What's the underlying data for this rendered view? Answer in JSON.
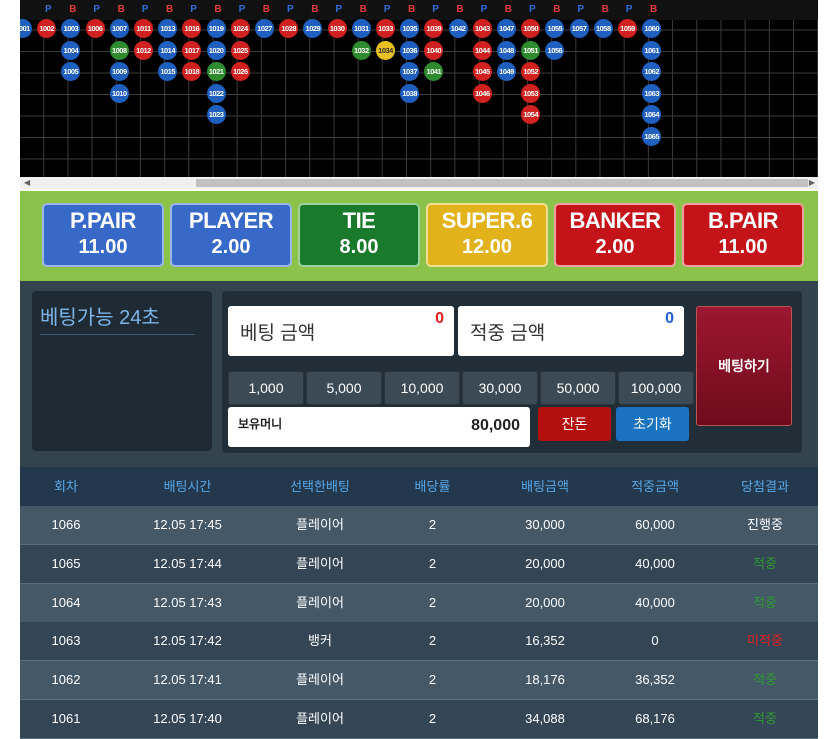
{
  "road": {
    "header": [
      "P",
      "B",
      "P",
      "B",
      "P",
      "B",
      "P",
      "B",
      "P",
      "B",
      "P",
      "B",
      "P",
      "B",
      "P",
      "B",
      "P",
      "B",
      "P",
      "B",
      "P",
      "B",
      "P",
      "B",
      "P",
      "B"
    ],
    "beads": [
      {
        "t": "1001",
        "c": "blue",
        "col": 0,
        "row": 0
      },
      {
        "t": "1002",
        "c": "red",
        "col": 1,
        "row": 0
      },
      {
        "t": "1003",
        "c": "blue",
        "col": 2,
        "row": 0
      },
      {
        "t": "1004",
        "c": "blue",
        "col": 2,
        "row": 1
      },
      {
        "t": "1005",
        "c": "blue",
        "col": 2,
        "row": 2
      },
      {
        "t": "1006",
        "c": "red",
        "col": 3,
        "row": 0
      },
      {
        "t": "1007",
        "c": "blue",
        "col": 4,
        "row": 0
      },
      {
        "t": "1008",
        "c": "green",
        "col": 4,
        "row": 1
      },
      {
        "t": "1009",
        "c": "blue",
        "col": 4,
        "row": 2
      },
      {
        "t": "1010",
        "c": "blue",
        "col": 4,
        "row": 3
      },
      {
        "t": "1011",
        "c": "red",
        "col": 5,
        "row": 0
      },
      {
        "t": "1012",
        "c": "red",
        "col": 5,
        "row": 1
      },
      {
        "t": "1013",
        "c": "blue",
        "col": 6,
        "row": 0
      },
      {
        "t": "1014",
        "c": "blue",
        "col": 6,
        "row": 1
      },
      {
        "t": "1015",
        "c": "blue",
        "col": 6,
        "row": 2
      },
      {
        "t": "1016",
        "c": "red",
        "col": 7,
        "row": 0
      },
      {
        "t": "1017",
        "c": "red",
        "col": 7,
        "row": 1
      },
      {
        "t": "1018",
        "c": "red",
        "col": 7,
        "row": 2
      },
      {
        "t": "1019",
        "c": "blue",
        "col": 8,
        "row": 0
      },
      {
        "t": "1020",
        "c": "blue",
        "col": 8,
        "row": 1
      },
      {
        "t": "1021",
        "c": "green",
        "col": 8,
        "row": 2
      },
      {
        "t": "1022",
        "c": "blue",
        "col": 8,
        "row": 3
      },
      {
        "t": "1023",
        "c": "blue",
        "col": 8,
        "row": 4
      },
      {
        "t": "1024",
        "c": "red",
        "col": 9,
        "row": 0
      },
      {
        "t": "1025",
        "c": "red",
        "col": 9,
        "row": 1
      },
      {
        "t": "1026",
        "c": "red",
        "col": 9,
        "row": 2
      },
      {
        "t": "1027",
        "c": "blue",
        "col": 10,
        "row": 0
      },
      {
        "t": "1028",
        "c": "red",
        "col": 11,
        "row": 0
      },
      {
        "t": "1029",
        "c": "blue",
        "col": 12,
        "row": 0
      },
      {
        "t": "1030",
        "c": "red",
        "col": 13,
        "row": 0
      },
      {
        "t": "1031",
        "c": "blue",
        "col": 14,
        "row": 0
      },
      {
        "t": "1032",
        "c": "green",
        "col": 14,
        "row": 1
      },
      {
        "t": "1033",
        "c": "red",
        "col": 15,
        "row": 0
      },
      {
        "t": "1034",
        "c": "yellow",
        "col": 15,
        "row": 1
      },
      {
        "t": "1035",
        "c": "blue",
        "col": 16,
        "row": 0
      },
      {
        "t": "1036",
        "c": "blue",
        "col": 16,
        "row": 1
      },
      {
        "t": "1037",
        "c": "blue",
        "col": 16,
        "row": 2
      },
      {
        "t": "1038",
        "c": "blue",
        "col": 16,
        "row": 3
      },
      {
        "t": "1039",
        "c": "red",
        "col": 17,
        "row": 0
      },
      {
        "t": "1040",
        "c": "red",
        "col": 17,
        "row": 1
      },
      {
        "t": "1041",
        "c": "green",
        "col": 17,
        "row": 2
      },
      {
        "t": "1042",
        "c": "blue",
        "col": 18,
        "row": 0
      },
      {
        "t": "1043",
        "c": "red",
        "col": 19,
        "row": 0
      },
      {
        "t": "1044",
        "c": "red",
        "col": 19,
        "row": 1
      },
      {
        "t": "1045",
        "c": "red",
        "col": 19,
        "row": 2
      },
      {
        "t": "1046",
        "c": "red",
        "col": 19,
        "row": 3
      },
      {
        "t": "1047",
        "c": "blue",
        "col": 20,
        "row": 0
      },
      {
        "t": "1048",
        "c": "blue",
        "col": 20,
        "row": 1
      },
      {
        "t": "1049",
        "c": "blue",
        "col": 20,
        "row": 2
      },
      {
        "t": "1050",
        "c": "red",
        "col": 21,
        "row": 0
      },
      {
        "t": "1051",
        "c": "green",
        "col": 21,
        "row": 1
      },
      {
        "t": "1052",
        "c": "red",
        "col": 21,
        "row": 2
      },
      {
        "t": "1053",
        "c": "red",
        "col": 21,
        "row": 3
      },
      {
        "t": "1054",
        "c": "red",
        "col": 21,
        "row": 4
      },
      {
        "t": "1055",
        "c": "blue",
        "col": 22,
        "row": 0
      },
      {
        "t": "1056",
        "c": "blue",
        "col": 22,
        "row": 1
      },
      {
        "t": "1057",
        "c": "blue",
        "col": 23,
        "row": 0
      },
      {
        "t": "1058",
        "c": "blue",
        "col": 24,
        "row": 0
      },
      {
        "t": "1059",
        "c": "red",
        "col": 25,
        "row": 0
      },
      {
        "t": "1060",
        "c": "blue",
        "col": 26,
        "row": 0
      },
      {
        "t": "1061",
        "c": "blue",
        "col": 26,
        "row": 1
      },
      {
        "t": "1062",
        "c": "blue",
        "col": 26,
        "row": 2
      },
      {
        "t": "1063",
        "c": "blue",
        "col": 26,
        "row": 3
      },
      {
        "t": "1064",
        "c": "blue",
        "col": 26,
        "row": 4
      },
      {
        "t": "1065",
        "c": "blue",
        "col": 26,
        "row": 5
      }
    ]
  },
  "bets": [
    {
      "title": "P.PAIR",
      "odds": "11.00",
      "color": "blue"
    },
    {
      "title": "PLAYER",
      "odds": "2.00",
      "color": "blue"
    },
    {
      "title": "TIE",
      "odds": "8.00",
      "color": "green"
    },
    {
      "title": "SUPER.6",
      "odds": "12.00",
      "color": "yellow"
    },
    {
      "title": "BANKER",
      "odds": "2.00",
      "color": "red"
    },
    {
      "title": "B.PAIR",
      "odds": "11.00",
      "color": "red"
    }
  ],
  "timer": {
    "label": "베팅가능 24초"
  },
  "bet_amount": {
    "label": "베팅 금액",
    "value": "0",
    "value_color": "#e02020"
  },
  "win_amount": {
    "label": "적중 금액",
    "value": "0",
    "value_color": "#2060d0"
  },
  "chips": [
    "1,000",
    "5,000",
    "10,000",
    "30,000",
    "50,000",
    "100,000"
  ],
  "holding": {
    "label": "보유머니",
    "value": "80,000"
  },
  "buttons": {
    "change": "잔돈",
    "reset": "초기화",
    "place_bet": "베팅하기"
  },
  "history": {
    "headers": [
      "회차",
      "배팅시간",
      "선택한배팅",
      "배당률",
      "배팅금액",
      "적중금액",
      "당첨결과"
    ],
    "rows": [
      {
        "round": "1066",
        "time": "12.05 17:45",
        "pick": "플레이어",
        "odds": "2",
        "bet": "30,000",
        "win": "60,000",
        "result": "진행중",
        "result_color": "#ffffff"
      },
      {
        "round": "1065",
        "time": "12.05 17:44",
        "pick": "플레이어",
        "odds": "2",
        "bet": "20,000",
        "win": "40,000",
        "result": "적중",
        "result_color": "#2e9a2e"
      },
      {
        "round": "1064",
        "time": "12.05 17:43",
        "pick": "플레이어",
        "odds": "2",
        "bet": "20,000",
        "win": "40,000",
        "result": "적중",
        "result_color": "#2e9a2e"
      },
      {
        "round": "1063",
        "time": "12.05 17:42",
        "pick": "뱅커",
        "odds": "2",
        "bet": "16,352",
        "win": "0",
        "result": "미적중",
        "result_color": "#e02020"
      },
      {
        "round": "1062",
        "time": "12.05 17:41",
        "pick": "플레이어",
        "odds": "2",
        "bet": "18,176",
        "win": "36,352",
        "result": "적중",
        "result_color": "#2e9a2e"
      },
      {
        "round": "1061",
        "time": "12.05 17:40",
        "pick": "플레이어",
        "odds": "2",
        "bet": "34,088",
        "win": "68,176",
        "result": "적중",
        "result_color": "#2e9a2e"
      }
    ]
  }
}
